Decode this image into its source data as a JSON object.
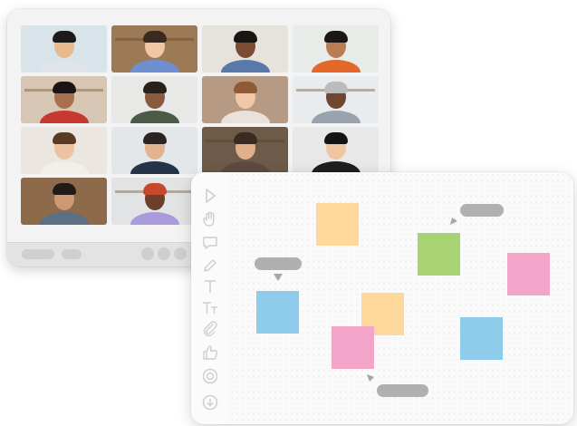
{
  "colors": {
    "note_orange": "#fed89b",
    "note_green": "#a8d372",
    "note_pink": "#f2a5c9",
    "note_blue": "#8fcbea",
    "comment_gray": "#b0b0b0",
    "tool_gray": "#cfcfcf"
  },
  "call": {
    "participants": [
      {
        "bg": "#d9e3ea",
        "skin": "#e8b98f",
        "hair": "#1d1a18",
        "shirt": "#dfe5ea"
      },
      {
        "bg": "#9b7a55",
        "skin": "#f0c6a4",
        "hair": "#3a2a1e",
        "shirt": "#6f8fd0"
      },
      {
        "bg": "#e6e2dc",
        "skin": "#7a4c33",
        "hair": "#1a1513",
        "shirt": "#5a78a8"
      },
      {
        "bg": "#e8ece9",
        "skin": "#b97d55",
        "hair": "#1f1714",
        "shirt": "#e4682a"
      },
      {
        "bg": "#d7c6b3",
        "skin": "#a7704e",
        "hair": "#1b1412",
        "shirt": "#c73930"
      },
      {
        "bg": "#e8e8e6",
        "skin": "#8a5a3e",
        "hair": "#2b1f1a",
        "shirt": "#4c5a48"
      },
      {
        "bg": "#b79a84",
        "skin": "#f0c7a7",
        "hair": "#8f5a35",
        "shirt": "#e8e2da"
      },
      {
        "bg": "#e9ecee",
        "skin": "#6f4631",
        "hair": "#bbbbbb",
        "shirt": "#98a3ad"
      },
      {
        "bg": "#ece6e0",
        "skin": "#edc2a1",
        "hair": "#5a3a25",
        "shirt": "#f2efea"
      },
      {
        "bg": "#e3e7ea",
        "skin": "#e3b38f",
        "hair": "#2b2420",
        "shirt": "#253447"
      },
      {
        "bg": "#6d5a48",
        "skin": "#e1b08a",
        "hair": "#3a2a22",
        "shirt": "#5e4a40"
      },
      {
        "bg": "#e8e8e8",
        "skin": "#f0c6a0",
        "hair": "#161314",
        "shirt": "#1f1f22"
      },
      {
        "bg": "#8c6a4a",
        "skin": "#cf9874",
        "hair": "#221a16",
        "shirt": "#5c6f84"
      },
      {
        "bg": "#e2e3e4",
        "skin": "#6b3f2a",
        "hair": "#c6482d",
        "shirt": "#a99bd9"
      }
    ],
    "controls": [
      "mic-control",
      "camera-control",
      "leave-control"
    ]
  },
  "whiteboard": {
    "tools": [
      "pointer-icon",
      "hand-icon",
      "comment-icon",
      "pen-icon",
      "text-icon",
      "text-size-icon",
      "attachment-icon",
      "thumbs-up-icon",
      "target-icon",
      "download-icon"
    ],
    "notes": [
      "orange",
      "green",
      "pink",
      "blue",
      "orange",
      "pink",
      "blue"
    ],
    "comments": 3
  }
}
